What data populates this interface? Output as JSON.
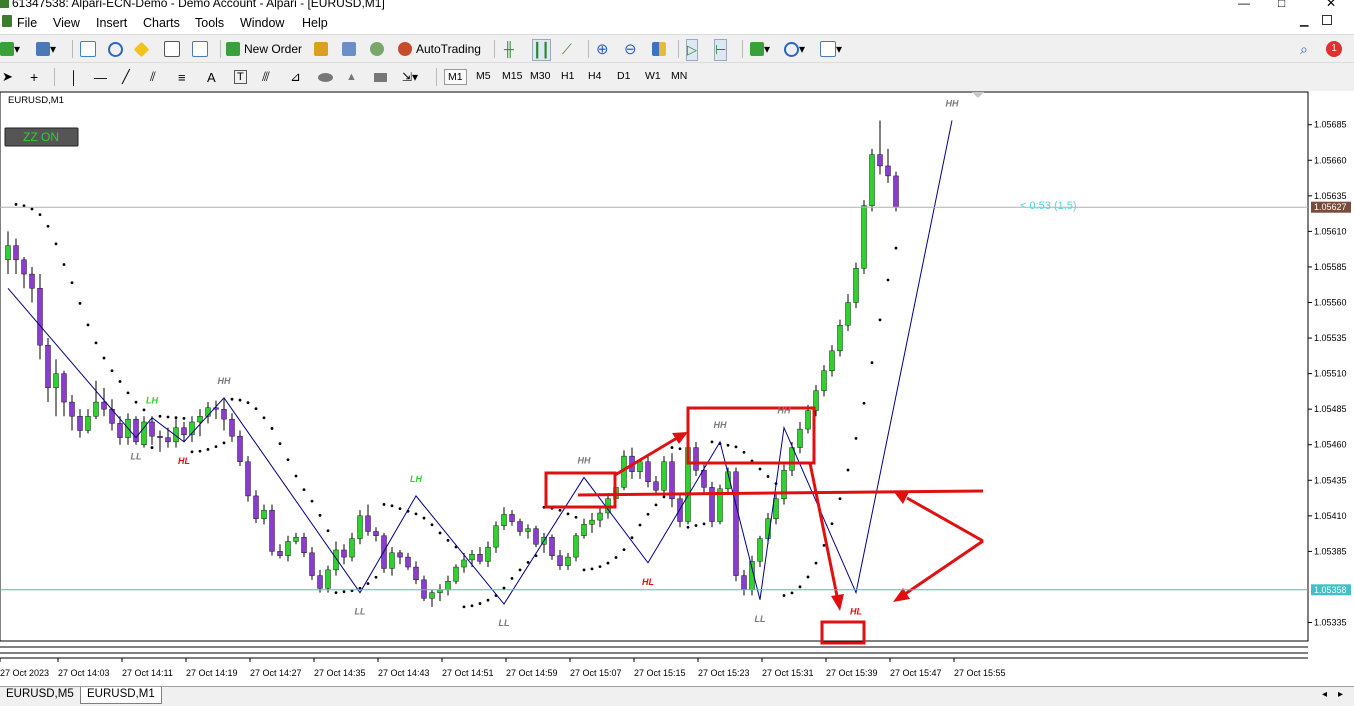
{
  "window": {
    "title": "61347538: Alpari-ECN-Demo - Demo Account - Alpari - [EURUSD,M1]"
  },
  "menu": [
    "File",
    "View",
    "Insert",
    "Charts",
    "Tools",
    "Window",
    "Help"
  ],
  "toolbar": {
    "new_order": "New Order",
    "autotrading": "AutoTrading",
    "alert_count": "1"
  },
  "timeframes": [
    "M1",
    "M5",
    "M15",
    "M30",
    "H1",
    "H4",
    "D1",
    "W1",
    "MN"
  ],
  "active_timeframe": "M1",
  "chart": {
    "symbol_label": "EURUSD,M1",
    "zz_button": "ZZ ON",
    "countdown": "< 0:53 (1.5)",
    "current_price": "1.05627",
    "hline_price": "1.05358"
  },
  "tabs": [
    "EURUSD,M5",
    "EURUSD,M1"
  ],
  "active_tab": "EURUSD,M1",
  "colors": {
    "bull": "#2fd12f",
    "bear": "#8c3ccf",
    "zigzag": "#00007f",
    "annotation": "#e01010",
    "hline": "#40c0c8",
    "lh_label": "#2fd12f",
    "hl_label": "#e01010",
    "hh_ll_label": "#7a7a7a"
  },
  "chart_data": {
    "type": "candlestick",
    "price_scale": [
      "1.05685",
      "1.05660",
      "1.05635",
      "1.05610",
      "1.05585",
      "1.05560",
      "1.05535",
      "1.05510",
      "1.05485",
      "1.05460",
      "1.05435",
      "1.05410",
      "1.05385",
      "1.05335"
    ],
    "ylim": [
      1.05322,
      1.05708
    ],
    "time_labels": [
      "27 Oct 2023",
      "27 Oct 14:03",
      "27 Oct 14:11",
      "27 Oct 14:19",
      "27 Oct 14:27",
      "27 Oct 14:35",
      "27 Oct 14:43",
      "27 Oct 14:51",
      "27 Oct 14:59",
      "27 Oct 15:07",
      "27 Oct 15:15",
      "27 Oct 15:23",
      "27 Oct 15:31",
      "27 Oct 15:39",
      "27 Oct 15:47",
      "27 Oct 15:55"
    ],
    "zigzag_labels": [
      {
        "text": "LL",
        "kind": "ll",
        "bar": 16
      },
      {
        "text": "LH",
        "kind": "lh",
        "bar": 18
      },
      {
        "text": "HL",
        "kind": "hl",
        "bar": 22
      },
      {
        "text": "HH",
        "kind": "hh",
        "bar": 27
      },
      {
        "text": "LL",
        "kind": "ll",
        "bar": 44
      },
      {
        "text": "LH",
        "kind": "lh",
        "bar": 51
      },
      {
        "text": "LL",
        "kind": "ll",
        "bar": 62
      },
      {
        "text": "HH",
        "kind": "hh",
        "bar": 72
      },
      {
        "text": "HL",
        "kind": "hl",
        "bar": 80
      },
      {
        "text": "HH",
        "kind": "hh",
        "bar": 89
      },
      {
        "text": "LL",
        "kind": "ll",
        "bar": 94
      },
      {
        "text": "HH",
        "kind": "hh",
        "bar": 97
      },
      {
        "text": "HL",
        "kind": "hl",
        "bar": 106
      },
      {
        "text": "HH",
        "kind": "hh",
        "bar": 118
      }
    ],
    "zigzag": [
      [
        0,
        1.0557
      ],
      [
        16,
        1.05465
      ],
      [
        18,
        1.05479
      ],
      [
        22,
        1.05462
      ],
      [
        27,
        1.05493
      ],
      [
        44,
        1.05356
      ],
      [
        51,
        1.05424
      ],
      [
        62,
        1.05348
      ],
      [
        72,
        1.05437
      ],
      [
        80,
        1.05377
      ],
      [
        89,
        1.05462
      ],
      [
        94,
        1.05351
      ],
      [
        97,
        1.05472
      ],
      [
        106,
        1.05356
      ],
      [
        118,
        1.05688
      ]
    ],
    "candles": [
      [
        1.0559,
        1.0561,
        1.0558,
        1.056
      ],
      [
        1.056,
        1.05605,
        1.0558,
        1.0559
      ],
      [
        1.0559,
        1.05592,
        1.0557,
        1.0558
      ],
      [
        1.0558,
        1.05585,
        1.0556,
        1.0557
      ],
      [
        1.0557,
        1.0558,
        1.0552,
        1.0553
      ],
      [
        1.0553,
        1.05535,
        1.0549,
        1.055
      ],
      [
        1.055,
        1.0552,
        1.0548,
        1.0551
      ],
      [
        1.0551,
        1.05512,
        1.0548,
        1.0549
      ],
      [
        1.0549,
        1.05495,
        1.0547,
        1.0548
      ],
      [
        1.0548,
        1.05485,
        1.05465,
        1.0547
      ],
      [
        1.0547,
        1.05485,
        1.05468,
        1.0548
      ],
      [
        1.0548,
        1.05505,
        1.05478,
        1.0549
      ],
      [
        1.0549,
        1.055,
        1.0548,
        1.05485
      ],
      [
        1.05485,
        1.05492,
        1.0547,
        1.05475
      ],
      [
        1.05475,
        1.0548,
        1.0546,
        1.05465
      ],
      [
        1.05465,
        1.05482,
        1.0546,
        1.05478
      ],
      [
        1.05478,
        1.0548,
        1.0546,
        1.05462
      ],
      [
        1.0546,
        1.0548,
        1.05458,
        1.05476
      ],
      [
        1.05476,
        1.0548,
        1.0546,
        1.05466
      ],
      [
        1.05466,
        1.0547,
        1.05455,
        1.05465
      ],
      [
        1.05465,
        1.05472,
        1.05458,
        1.05462
      ],
      [
        1.05462,
        1.05478,
        1.05458,
        1.05472
      ],
      [
        1.05472,
        1.05476,
        1.05462,
        1.05467
      ],
      [
        1.05467,
        1.0548,
        1.05462,
        1.05476
      ],
      [
        1.05476,
        1.05485,
        1.05466,
        1.0548
      ],
      [
        1.0548,
        1.0549,
        1.05475,
        1.05486
      ],
      [
        1.05486,
        1.05491,
        1.05478,
        1.05485
      ],
      [
        1.05485,
        1.05492,
        1.0547,
        1.05478
      ],
      [
        1.05478,
        1.05482,
        1.05462,
        1.05466
      ],
      [
        1.05466,
        1.0547,
        1.05445,
        1.05448
      ],
      [
        1.05448,
        1.05452,
        1.0542,
        1.05424
      ],
      [
        1.05424,
        1.05428,
        1.05405,
        1.05408
      ],
      [
        1.05408,
        1.05418,
        1.05404,
        1.05414
      ],
      [
        1.05414,
        1.05418,
        1.05382,
        1.05385
      ],
      [
        1.05385,
        1.0539,
        1.0538,
        1.05382
      ],
      [
        1.05382,
        1.05396,
        1.05378,
        1.05392
      ],
      [
        1.05392,
        1.05398,
        1.0539,
        1.05395
      ],
      [
        1.05395,
        1.05398,
        1.05381,
        1.05384
      ],
      [
        1.05384,
        1.05388,
        1.05365,
        1.05368
      ],
      [
        1.05368,
        1.05372,
        1.05356,
        1.05359
      ],
      [
        1.05359,
        1.05375,
        1.05356,
        1.05372
      ],
      [
        1.05372,
        1.05392,
        1.05368,
        1.05386
      ],
      [
        1.05386,
        1.0539,
        1.05376,
        1.05381
      ],
      [
        1.05381,
        1.05398,
        1.05378,
        1.05394
      ],
      [
        1.05394,
        1.05414,
        1.0539,
        1.0541
      ],
      [
        1.0541,
        1.05418,
        1.05396,
        1.05399
      ],
      [
        1.05399,
        1.05402,
        1.05392,
        1.05396
      ],
      [
        1.05396,
        1.05398,
        1.0537,
        1.05373
      ],
      [
        1.05373,
        1.05388,
        1.05368,
        1.05384
      ],
      [
        1.05384,
        1.05386,
        1.05376,
        1.05381
      ],
      [
        1.05381,
        1.05384,
        1.05372,
        1.05374
      ],
      [
        1.05374,
        1.05378,
        1.05362,
        1.05365
      ],
      [
        1.05365,
        1.05368,
        1.0535,
        1.05352
      ],
      [
        1.05352,
        1.05358,
        1.05346,
        1.05356
      ],
      [
        1.05356,
        1.05362,
        1.0535,
        1.05358
      ],
      [
        1.05358,
        1.05368,
        1.05354,
        1.05364
      ],
      [
        1.05364,
        1.05376,
        1.05362,
        1.05374
      ],
      [
        1.05374,
        1.05384,
        1.0537,
        1.05379
      ],
      [
        1.05379,
        1.05386,
        1.05374,
        1.05383
      ],
      [
        1.05383,
        1.05388,
        1.05376,
        1.05378
      ],
      [
        1.05378,
        1.05392,
        1.05374,
        1.05388
      ],
      [
        1.05388,
        1.05406,
        1.05384,
        1.05403
      ],
      [
        1.05403,
        1.05416,
        1.054,
        1.05411
      ],
      [
        1.05411,
        1.05414,
        1.05403,
        1.05406
      ],
      [
        1.05406,
        1.05408,
        1.05396,
        1.05399
      ],
      [
        1.05399,
        1.05404,
        1.05394,
        1.05401
      ],
      [
        1.05401,
        1.05403,
        1.05388,
        1.0539
      ],
      [
        1.0539,
        1.05398,
        1.05384,
        1.05395
      ],
      [
        1.05395,
        1.05397,
        1.05379,
        1.05382
      ],
      [
        1.05382,
        1.05386,
        1.05372,
        1.05375
      ],
      [
        1.05375,
        1.05384,
        1.05372,
        1.05381
      ],
      [
        1.05381,
        1.05398,
        1.05378,
        1.05396
      ],
      [
        1.05396,
        1.05408,
        1.05394,
        1.05404
      ],
      [
        1.05404,
        1.05412,
        1.05398,
        1.05407
      ],
      [
        1.05407,
        1.05416,
        1.05402,
        1.05412
      ],
      [
        1.05412,
        1.05426,
        1.05408,
        1.05422
      ],
      [
        1.05422,
        1.05436,
        1.05418,
        1.0543
      ],
      [
        1.0543,
        1.05456,
        1.05428,
        1.05452
      ],
      [
        1.05452,
        1.05458,
        1.05436,
        1.05441
      ],
      [
        1.05441,
        1.0545,
        1.05436,
        1.05448
      ],
      [
        1.05448,
        1.05452,
        1.0543,
        1.05434
      ],
      [
        1.05434,
        1.05438,
        1.05425,
        1.05428
      ],
      [
        1.05428,
        1.05452,
        1.05424,
        1.05448
      ],
      [
        1.05448,
        1.05454,
        1.05416,
        1.05422
      ],
      [
        1.05422,
        1.05426,
        1.05402,
        1.05406
      ],
      [
        1.05406,
        1.05462,
        1.05404,
        1.05458
      ],
      [
        1.05458,
        1.05462,
        1.05438,
        1.05442
      ],
      [
        1.05442,
        1.05446,
        1.05426,
        1.0543
      ],
      [
        1.0543,
        1.05434,
        1.05402,
        1.05406
      ],
      [
        1.05406,
        1.05432,
        1.05404,
        1.05429
      ],
      [
        1.05429,
        1.05444,
        1.05426,
        1.05441
      ],
      [
        1.05441,
        1.05444,
        1.05364,
        1.05368
      ],
      [
        1.05368,
        1.05372,
        1.05354,
        1.05358
      ],
      [
        1.05358,
        1.05382,
        1.05354,
        1.05378
      ],
      [
        1.05378,
        1.05396,
        1.05374,
        1.05394
      ],
      [
        1.05394,
        1.05412,
        1.0539,
        1.05408
      ],
      [
        1.05408,
        1.05426,
        1.05404,
        1.05422
      ],
      [
        1.05422,
        1.05446,
        1.05418,
        1.05442
      ],
      [
        1.05442,
        1.05462,
        1.05438,
        1.05458
      ],
      [
        1.05458,
        1.05476,
        1.05454,
        1.05471
      ],
      [
        1.05471,
        1.05488,
        1.05468,
        1.05484
      ],
      [
        1.05484,
        1.05502,
        1.0548,
        1.05498
      ],
      [
        1.05498,
        1.05516,
        1.05494,
        1.05512
      ],
      [
        1.05512,
        1.0553,
        1.05508,
        1.05526
      ],
      [
        1.05526,
        1.05548,
        1.05522,
        1.05544
      ],
      [
        1.05544,
        1.05566,
        1.0554,
        1.0556
      ],
      [
        1.0556,
        1.05588,
        1.05556,
        1.05584
      ],
      [
        1.05584,
        1.05632,
        1.0558,
        1.05628
      ],
      [
        1.05628,
        1.05668,
        1.05624,
        1.05664
      ],
      [
        1.05664,
        1.05688,
        1.0565,
        1.05656
      ],
      [
        1.05656,
        1.05668,
        1.05644,
        1.05649
      ],
      [
        1.05649,
        1.05652,
        1.05624,
        1.05627
      ]
    ]
  }
}
